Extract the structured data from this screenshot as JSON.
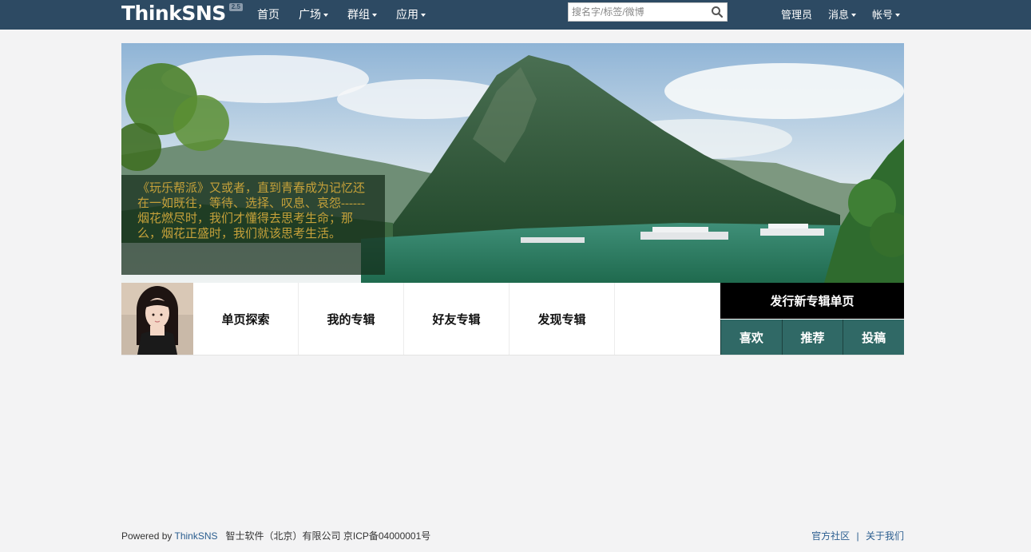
{
  "header": {
    "logo_text": "ThinkSNS",
    "logo_version": "2.5",
    "nav": [
      {
        "label": "首页",
        "dropdown": false
      },
      {
        "label": "广场",
        "dropdown": true
      },
      {
        "label": "群组",
        "dropdown": true
      },
      {
        "label": "应用",
        "dropdown": true
      }
    ],
    "search_placeholder": "搜名字/标签/微博",
    "right_nav": [
      {
        "label": "管理员",
        "dropdown": false
      },
      {
        "label": "消息",
        "dropdown": true
      },
      {
        "label": "帐号",
        "dropdown": true
      }
    ],
    "bg_color": "#2d4a63"
  },
  "banner": {
    "caption": "《玩乐帮派》又或者，直到青春成为记忆还在一如既往，等待、选择、叹息、哀怨------烟花燃尽时，我们才懂得去思考生命；那么，烟花正盛时，我们就该思考生活。",
    "caption_color": "#c5a13a"
  },
  "profile": {
    "tabs": [
      "单页探索",
      "我的专辑",
      "好友专辑",
      "发现专辑"
    ],
    "publish_label": "发行新专辑单页",
    "actions": [
      "喜欢",
      "推荐",
      "投稿"
    ],
    "action_color": "#306966"
  },
  "footer": {
    "powered_by": "Powered by",
    "brand_link": "ThinkSNS",
    "company": "智士软件（北京）有限公司 京ICP备04000001号",
    "links": [
      "官方社区",
      "关于我们"
    ],
    "link_separator": "|"
  }
}
